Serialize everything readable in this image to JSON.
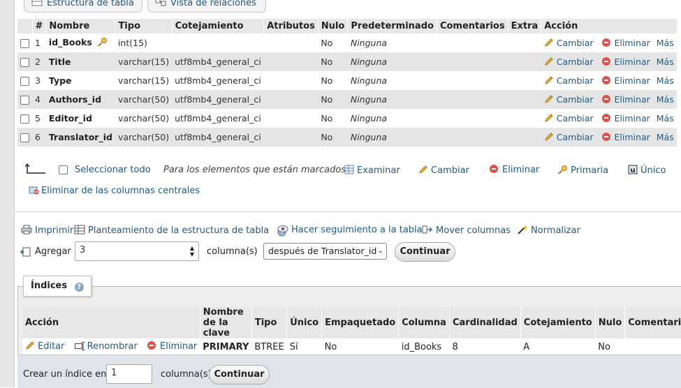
{
  "tabs": [
    {
      "label": "Estructura de tabla",
      "icon": "table-structure-icon"
    },
    {
      "label": "Vista de relaciones",
      "icon": "relations-icon"
    }
  ],
  "columns_table": {
    "headers": [
      "#",
      "Nombre",
      "Tipo",
      "Cotejamiento",
      "Atributos",
      "Nulo",
      "Predeterminado",
      "Comentarios",
      "Extra",
      "Acción"
    ],
    "rows": [
      {
        "num": "1",
        "name": "id_Books",
        "type": "int(15)",
        "collation": "",
        "attributes": "",
        "null": "No",
        "default": "Ninguna",
        "comments": "",
        "extra": "",
        "is_primary": true
      },
      {
        "num": "2",
        "name": "Title",
        "type": "varchar(15)",
        "collation": "utf8mb4_general_ci",
        "attributes": "",
        "null": "No",
        "default": "Ninguna",
        "comments": "",
        "extra": ""
      },
      {
        "num": "3",
        "name": "Type",
        "type": "varchar(15)",
        "collation": "utf8mb4_general_ci",
        "attributes": "",
        "null": "No",
        "default": "Ninguna",
        "comments": "",
        "extra": ""
      },
      {
        "num": "4",
        "name": "Authors_id",
        "type": "varchar(50)",
        "collation": "utf8mb4_general_ci",
        "attributes": "",
        "null": "No",
        "default": "Ninguna",
        "comments": "",
        "extra": ""
      },
      {
        "num": "5",
        "name": "Editor_id",
        "type": "varchar(50)",
        "collation": "utf8mb4_general_ci",
        "attributes": "",
        "null": "No",
        "default": "Ninguna",
        "comments": "",
        "extra": ""
      },
      {
        "num": "6",
        "name": "Translator_id",
        "type": "varchar(50)",
        "collation": "utf8mb4_general_ci",
        "attributes": "",
        "null": "No",
        "default": "Ninguna",
        "comments": "",
        "extra": ""
      }
    ],
    "row_actions": {
      "change": "Cambiar",
      "delete": "Eliminar",
      "more": "Más"
    }
  },
  "bulk": {
    "select_all": "Seleccionar todo",
    "with_selected": "Para los elementos que están marcados:",
    "browse": "Examinar",
    "change": "Cambiar",
    "delete": "Eliminar",
    "primary": "Primaria",
    "unique": "Único",
    "remove_central": "Eliminar de las columnas centrales"
  },
  "toolbar": {
    "print": "Imprimir",
    "plan": "Planteamiento de la estructura de tabla",
    "track": "Hacer seguimiento a la tabla",
    "move": "Mover columnas",
    "normalize": "Normalizar"
  },
  "add_column": {
    "label": "Agregar",
    "count": "3",
    "unit": "columna(s)",
    "position": "después de Translator_id",
    "submit": "Continuar"
  },
  "indexes": {
    "title": "Índices",
    "headers": [
      "Acción",
      "Nombre de la clave",
      "Tipo",
      "Único",
      "Empaquetado",
      "Columna",
      "Cardinalidad",
      "Cotejamiento",
      "Nulo",
      "Comentario"
    ],
    "actions": {
      "edit": "Editar",
      "rename": "Renombrar",
      "delete": "Eliminar"
    },
    "row": {
      "key": "PRIMARY",
      "type": "BTREE",
      "unique": "Sí",
      "packed": "No",
      "column": "id_Books",
      "cardinality": "8",
      "collation": "A",
      "null": "No",
      "comment": ""
    },
    "create_label": "Crear un índice en",
    "create_count": "1",
    "create_unit": "columna(s)",
    "create_submit": "Continuar"
  },
  "colors": {
    "link": "#235a81",
    "header_bg": "#e7e7e7",
    "row_alt": "#e5e5e5",
    "delete_red": "#d9534f"
  }
}
